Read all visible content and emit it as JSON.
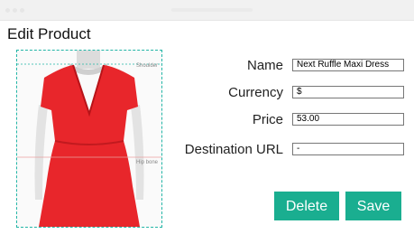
{
  "window": {
    "title": "Edit Product"
  },
  "image": {
    "guide_shoulder": "Shoulder",
    "guide_hip": "Hip bone"
  },
  "form": {
    "name_label": "Name",
    "name_value": "Next Ruffle Maxi Dress",
    "currency_label": "Currency",
    "currency_value": "$",
    "price_label": "Price",
    "price_value": "53.00",
    "url_label": "Destination URL",
    "url_value": "-"
  },
  "buttons": {
    "delete": "Delete",
    "save": "Save"
  },
  "colors": {
    "accent": "#1aae90",
    "dress": "#e8262b",
    "guide": "#22b5a6"
  }
}
